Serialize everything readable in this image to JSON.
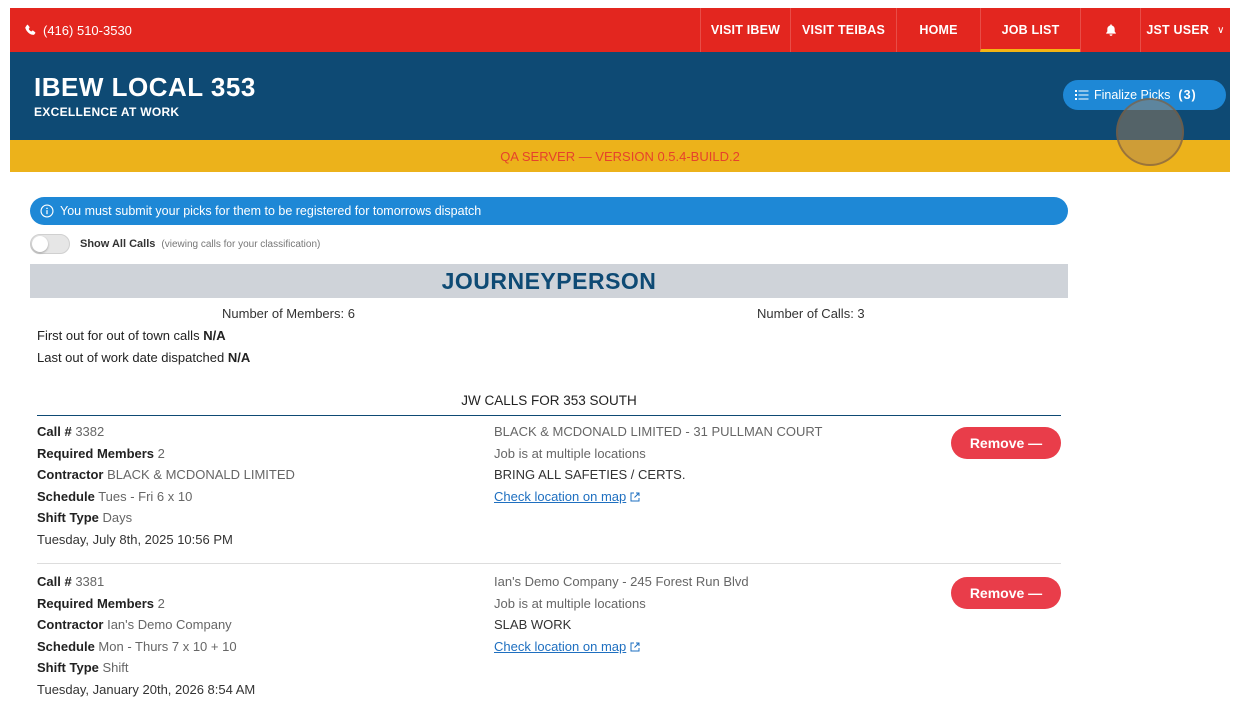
{
  "topbar": {
    "phone": "(416) 510-3530",
    "nav": [
      {
        "label": "VISIT IBEW"
      },
      {
        "label": "VISIT TEIBAS"
      },
      {
        "label": "HOME"
      },
      {
        "label": "JOB LIST"
      },
      {
        "label": ""
      },
      {
        "label": "JST USER"
      }
    ],
    "active": "JOB LIST"
  },
  "header": {
    "title": "IBEW LOCAL 353",
    "subtitle": "EXCELLENCE AT WORK",
    "finalize_label": "Finalize Picks",
    "finalize_count": "(3)"
  },
  "qa_banner": "QA SERVER — VERSION 0.5.4-BUILD.2",
  "notice": "You must submit your picks for them to be registered for tomorrows dispatch",
  "toggle": {
    "label": "Show All Calls",
    "note": "(viewing calls for your classification)"
  },
  "classification": {
    "title": "JOURNEYPERSON",
    "members_label": "Number of Members: 6",
    "calls_label": "Number of Calls: 3",
    "first_out_label": "First out for out of town calls",
    "first_out_value": "N/A",
    "last_out_label": "Last out of work date dispatched",
    "last_out_value": "N/A"
  },
  "calls_heading": "JW CALLS FOR 353 SOUTH",
  "labels": {
    "call": "Call #",
    "required": "Required Members",
    "contractor": "Contractor",
    "schedule": "Schedule",
    "shift": "Shift Type",
    "map": "Check location on map",
    "remove": "Remove —"
  },
  "calls": [
    {
      "number": "3382",
      "required": "2",
      "contractor": "BLACK & MCDONALD LIMITED",
      "schedule": "Tues - Fri 6 x 10",
      "shift": "Days",
      "posted": "Tuesday, July 8th, 2025 10:56 PM",
      "location": "BLACK & MCDONALD LIMITED - 31 PULLMAN COURT",
      "locations_note": "Job is at multiple locations",
      "notes": "BRING ALL SAFETIES / CERTS."
    },
    {
      "number": "3381",
      "required": "2",
      "contractor": "Ian's Demo Company",
      "schedule": "Mon - Thurs 7 x 10 + 10",
      "shift": "Shift",
      "posted": "Tuesday, January 20th, 2026 8:54 AM",
      "location": "Ian's Demo Company - 245 Forest Run Blvd",
      "locations_note": "Job is at multiple locations",
      "notes": "SLAB WORK"
    }
  ],
  "colors": {
    "topbar": "#e3261f",
    "header": "#0e4a74",
    "qa": "#ecb21b",
    "accent": "#1e88d6",
    "remove": "#e93d4a"
  }
}
